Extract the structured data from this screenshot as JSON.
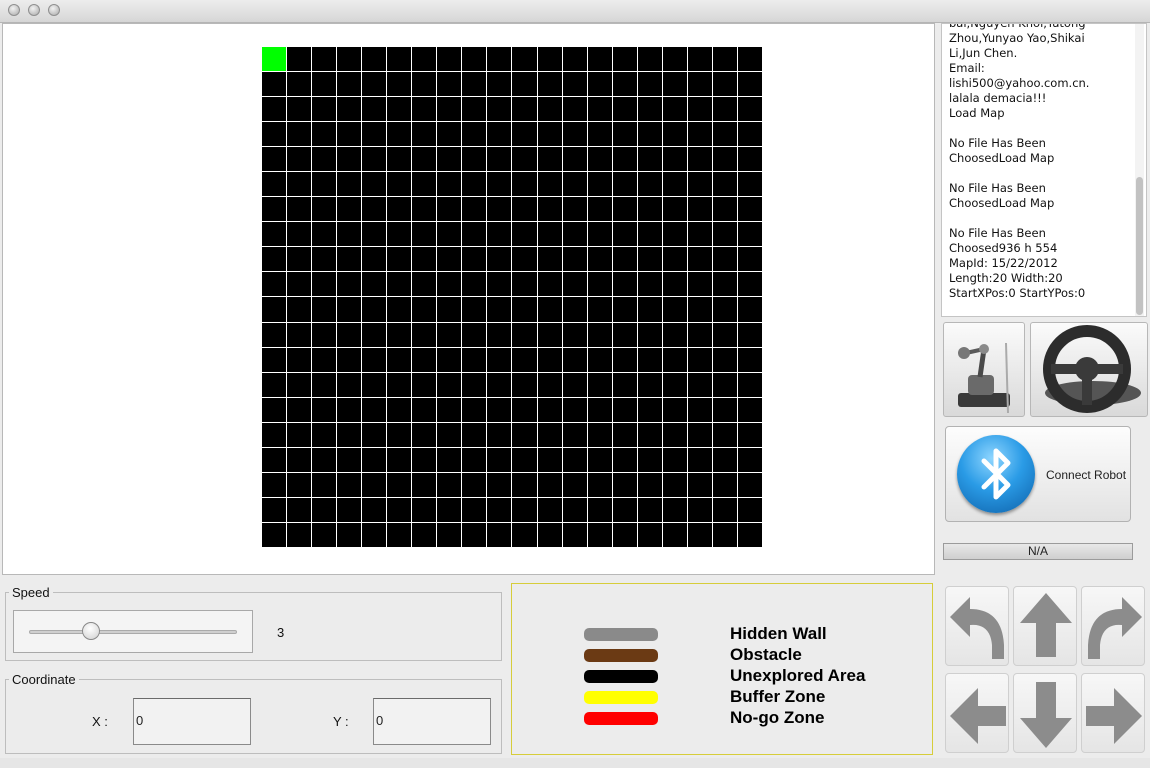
{
  "window": {
    "buttons": [
      "close",
      "minimize",
      "zoom"
    ]
  },
  "map": {
    "rows": 20,
    "cols": 20,
    "start_cell": {
      "row": 0,
      "col": 0
    },
    "colors": {
      "start": "#00ff00",
      "unexplored": "#000000",
      "gridline": "#ffffff"
    }
  },
  "log": {
    "text": "bai,Nguyen Khoi,Yatong\nZhou,Yunyao Yao,Shikai\nLi,Jun Chen.\nEmail:\nlishi500@yahoo.com.cn.\nlalala demacia!!!\nLoad Map\n\nNo File Has Been\nChoosedLoad Map\n\nNo File Has Been\nChoosedLoad Map\n\nNo File Has Been\nChoosed936 h 554\nMapId: 15/22/2012\nLength:20 Width:20\nStartXPos:0 StartYPos:0"
  },
  "tools": {
    "robot_arm_icon": "robot-arm-icon",
    "steering_wheel_icon": "steering-wheel-icon"
  },
  "connect": {
    "label": "Connect Robot",
    "icon": "bluetooth-icon"
  },
  "status": {
    "text": "N/A"
  },
  "speed": {
    "legend": "Speed",
    "value": "3",
    "min": 0,
    "max": 10,
    "level": 3
  },
  "coordinate": {
    "legend": "Coordinate",
    "x_label": "X :",
    "y_label": "Y :",
    "x_value": "0",
    "y_value": "0"
  },
  "legend": {
    "items": [
      {
        "label": "Hidden Wall",
        "color": "#8a8a8a"
      },
      {
        "label": "Obstacle",
        "color": "#6b3a14"
      },
      {
        "label": "Unexplored Area",
        "color": "#000000"
      },
      {
        "label": "Buffer Zone",
        "color": "#ffff00"
      },
      {
        "label": "No-go Zone",
        "color": "#ff0000"
      }
    ]
  },
  "controls": {
    "buttons": [
      "turn-left",
      "move-up",
      "turn-right",
      "move-left",
      "move-down",
      "move-right"
    ]
  }
}
